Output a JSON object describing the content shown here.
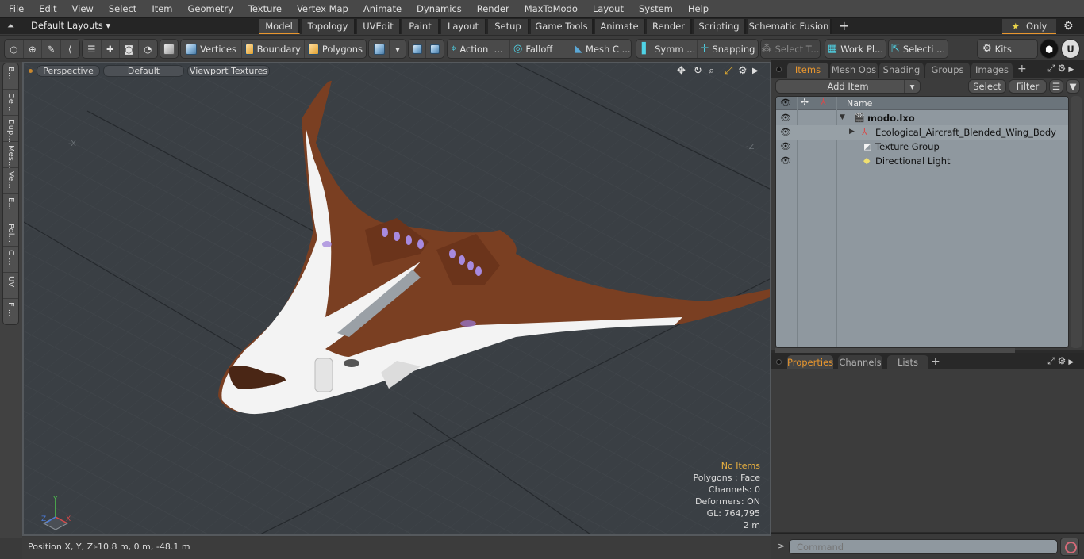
{
  "menubar": {
    "items": [
      "File",
      "Edit",
      "View",
      "Select",
      "Item",
      "Geometry",
      "Texture",
      "Vertex Map",
      "Animate",
      "Dynamics",
      "Render",
      "MaxToModo",
      "Layout",
      "System",
      "Help"
    ]
  },
  "layoutbar": {
    "layouts_label": "Default Layouts",
    "tabs": [
      "Model",
      "Topology",
      "UVEdit",
      "Paint",
      "Layout",
      "Setup",
      "Game Tools",
      "Animate",
      "Render",
      "Scripting",
      "Schematic Fusion"
    ],
    "active_tab": "Model",
    "add_tab": "+",
    "only_label": "Only"
  },
  "toolbar": {
    "vertices": "Vertices",
    "boundary": "Boundary",
    "polygons": "Polygons",
    "action": "Action",
    "action_more": "...",
    "falloff": "Falloff",
    "mesh_c": "Mesh C ...",
    "symm": "Symm ...",
    "snapping": "Snapping",
    "select_t": "Select T...",
    "work_pl": "Work Pl...",
    "selecti": "Selecti ...",
    "kits": "Kits"
  },
  "lefttabs": [
    "B...",
    "De...",
    "Dup...",
    "Mes...",
    "Ve...",
    "E...",
    "Pol...",
    "C ...",
    "UV",
    "F ..."
  ],
  "viewport": {
    "view_mode": "Perspective",
    "shading": "Default",
    "textures": "Viewport Textures",
    "axis_x": "-X",
    "axis_z": "-Z",
    "info": {
      "selection": "No Items",
      "polygons": "Polygons : Face",
      "channels": "Channels: 0",
      "deformers": "Deformers: ON",
      "gl": "GL: 764,795",
      "scale": "2 m"
    },
    "gizmo": {
      "x": "X",
      "y": "Y",
      "z": "Z"
    }
  },
  "statusbar": {
    "label": "Position X, Y, Z:",
    "value": "-10.8 m, 0 m, -48.1 m"
  },
  "itemspanel": {
    "tabs": [
      "Items",
      "Mesh Ops",
      "Shading",
      "Groups",
      "Images"
    ],
    "active_tab": "Items",
    "add_item": "Add Item",
    "select": "Select",
    "filter": "Filter",
    "column_name": "Name",
    "items": [
      {
        "name": "modo.lxo",
        "type": "scene",
        "bold": true
      },
      {
        "name": "Ecological_Aircraft_Blended_Wing_Body",
        "type": "mesh"
      },
      {
        "name": "Texture Group",
        "type": "texture-group"
      },
      {
        "name": "Directional Light",
        "type": "light"
      }
    ]
  },
  "proppanel": {
    "tabs": [
      "Properties",
      "Channels",
      "Lists"
    ],
    "active_tab": "Properties"
  },
  "command": {
    "prompt": ">",
    "placeholder": "Command"
  },
  "colors": {
    "accent": "#e8962e",
    "aircraft_body": "#f2f2f2",
    "aircraft_brown": "#7a3f22",
    "aircraft_purple": "#9a7ad8",
    "viewport_bg": "#3a3f44"
  }
}
